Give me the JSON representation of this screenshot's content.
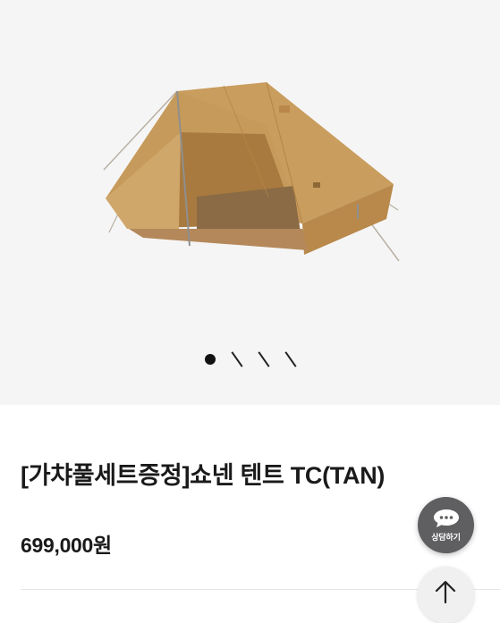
{
  "product": {
    "title": "[가챠풀세트증정]쇼넨 텐트 TC(TAN)",
    "price": "699,000원",
    "image_icon": "tent-image"
  },
  "gallery": {
    "indicators": [
      "active-dot",
      "slash",
      "slash",
      "slash"
    ]
  },
  "floating": {
    "chat_label": "상담하기",
    "chat_icon": "chat-bubble-icon",
    "top_icon": "arrow-up-icon"
  },
  "colors": {
    "tent": "#c69a5a",
    "tent_shadow": "#a87a3f",
    "chat_button": "#5f5f62"
  }
}
